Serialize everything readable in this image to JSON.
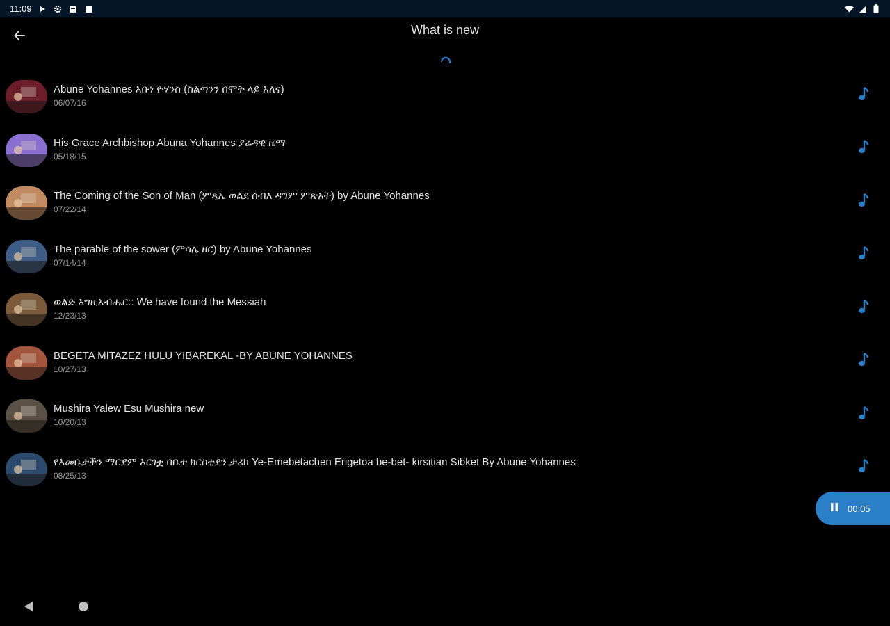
{
  "status_bar": {
    "time": "11:09",
    "icons": [
      "play-icon",
      "settings-icon",
      "notification-icon",
      "sd-card-icon",
      "wifi-icon",
      "signal-icon",
      "battery-icon"
    ]
  },
  "app_bar": {
    "title": "What is new",
    "back_icon": "arrow-back-icon"
  },
  "loading": {
    "icon": "spinner-icon",
    "color": "#2a7fc6"
  },
  "items": [
    {
      "title": "Abune Yohannes እቡነ ዮሃንስ (ስልጣንን በሞት ላይ አለና)",
      "date": "06/07/16",
      "thumb_color": "#6b1d2a"
    },
    {
      "title": "His Grace Archbishop Abuna Yohannes ያሬዳዊ ዜማ",
      "date": "05/18/15",
      "thumb_color": "#8a6fd1"
    },
    {
      "title": "The Coming of the Son of Man (ምጻኤ ወልደ ሰብእ ዳግም ምጽአት) by Abune Yohannes",
      "date": "07/22/14",
      "thumb_color": "#c28a60"
    },
    {
      "title": "The parable of the sower (ምሳሌ ዘር) by Abune Yohannes",
      "date": "07/14/14",
      "thumb_color": "#3d5d86"
    },
    {
      "title": "ወልድ እግዚአብሔር:: We have found the Messiah",
      "date": "12/23/13",
      "thumb_color": "#7a5a3a"
    },
    {
      "title": "BEGETA MITAZEZ HULU YIBAREKAL -BY  ABUNE YOHANNES",
      "date": "10/27/13",
      "thumb_color": "#a2543c"
    },
    {
      "title": "Mushira Yalew Esu Mushira new",
      "date": "10/20/13",
      "thumb_color": "#5a5046"
    },
    {
      "title": "የእመቤታችን ማርያም እርገቷ በቤተ ክርስቲያን ታሪክ  Ye-Emebetachen Erigetoa be-bet- kirsitian Sibket By Abune Yohannes",
      "date": "08/25/13",
      "thumb_color": "#2c4a6e"
    }
  ],
  "item_action_icon": "music-note-icon",
  "player": {
    "icon": "pause-icon",
    "time": "00:05",
    "color": "#2a7fc6"
  },
  "nav_bar": {
    "icons": [
      "nav-back-icon",
      "nav-home-icon"
    ]
  }
}
